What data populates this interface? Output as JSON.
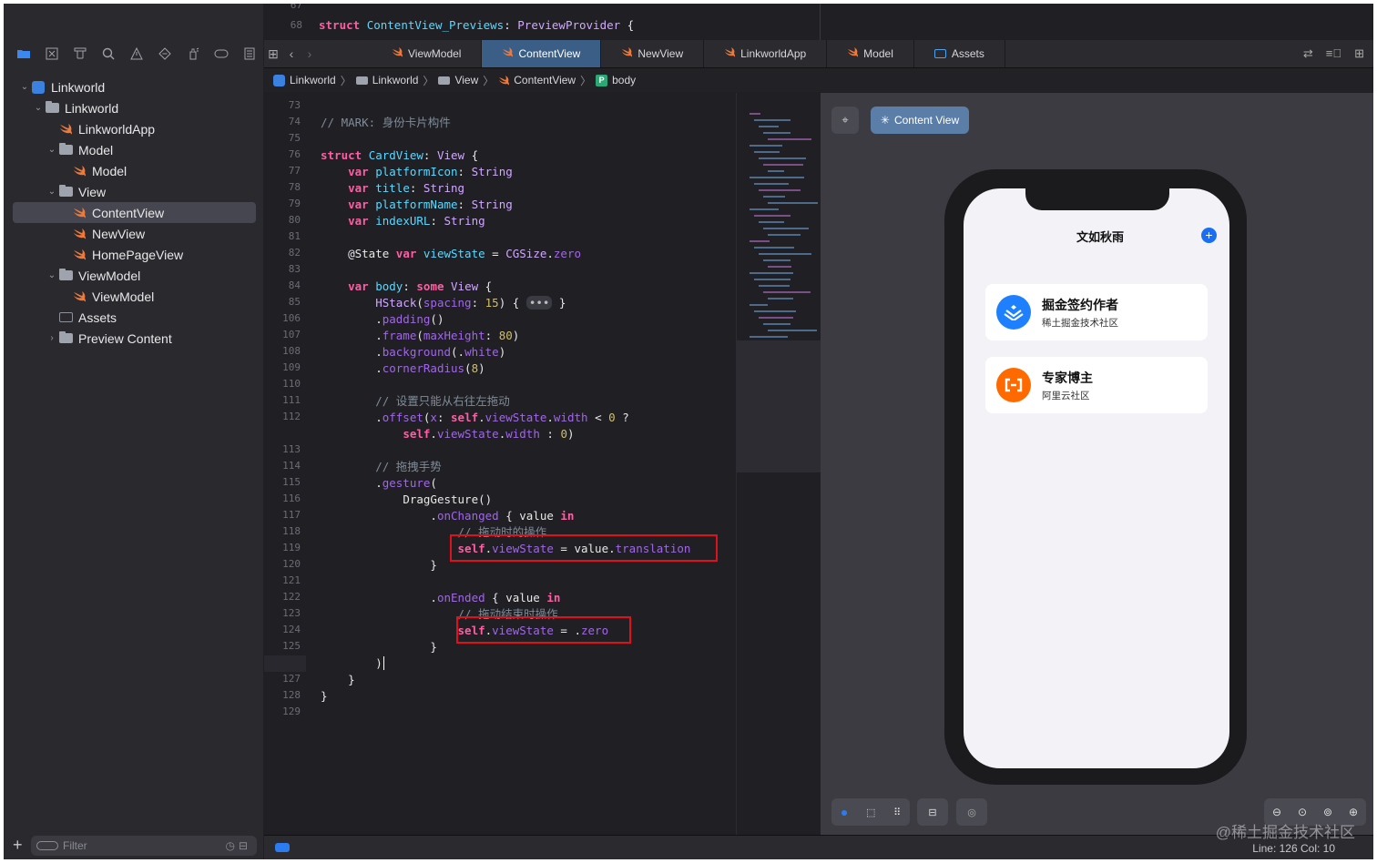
{
  "top_code": {
    "line_no_67": "67",
    "line_no_68": "68",
    "line_68_kw": "struct",
    "line_68_name": "ContentView_Previews",
    "line_68_rest": ": ",
    "line_68_type": "PreviewProvider",
    "line_68_end": " {"
  },
  "toolbar": {
    "icons": [
      "folder-icon",
      "x-square-icon",
      "hierarchy-icon",
      "search-icon",
      "warning-icon",
      "diamond-icon",
      "spray-icon",
      "tag-icon",
      "list-icon"
    ]
  },
  "tree": [
    {
      "label": "Linkworld",
      "depth": 0,
      "icon": "project-icon",
      "disclosure": "open"
    },
    {
      "label": "Linkworld",
      "depth": 1,
      "icon": "folder-icon",
      "disclosure": "open"
    },
    {
      "label": "LinkworldApp",
      "depth": 2,
      "icon": "swift-icon",
      "disclosure": ""
    },
    {
      "label": "Model",
      "depth": 2,
      "icon": "folder-icon",
      "disclosure": "open"
    },
    {
      "label": "Model",
      "depth": 3,
      "icon": "swift-icon",
      "disclosure": ""
    },
    {
      "label": "View",
      "depth": 2,
      "icon": "folder-icon",
      "disclosure": "open"
    },
    {
      "label": "ContentView",
      "depth": 3,
      "icon": "swift-icon",
      "disclosure": "",
      "selected": true
    },
    {
      "label": "NewView",
      "depth": 3,
      "icon": "swift-icon",
      "disclosure": ""
    },
    {
      "label": "HomePageView",
      "depth": 3,
      "icon": "swift-icon",
      "disclosure": ""
    },
    {
      "label": "ViewModel",
      "depth": 2,
      "icon": "folder-icon",
      "disclosure": "open"
    },
    {
      "label": "ViewModel",
      "depth": 3,
      "icon": "swift-icon",
      "disclosure": ""
    },
    {
      "label": "Assets",
      "depth": 2,
      "icon": "assets-icon",
      "disclosure": ""
    },
    {
      "label": "Preview Content",
      "depth": 2,
      "icon": "folder-icon",
      "disclosure": "closed"
    }
  ],
  "filter": {
    "placeholder": "Filter"
  },
  "tabs": [
    {
      "label": "ViewModel",
      "active": false
    },
    {
      "label": "ContentView",
      "active": true
    },
    {
      "label": "NewView",
      "active": false
    },
    {
      "label": "LinkworldApp",
      "active": false
    },
    {
      "label": "Model",
      "active": false
    },
    {
      "label": "Assets",
      "active": false
    }
  ],
  "breadcrumb": [
    "Linkworld",
    "Linkworld",
    "View",
    "ContentView",
    "body"
  ],
  "code_lines": [
    {
      "n": "73",
      "html": ""
    },
    {
      "n": "74",
      "html": "<span class='cm'>// MARK: 身份卡片构件</span>"
    },
    {
      "n": "75",
      "html": ""
    },
    {
      "n": "76",
      "html": "<span class='kw'>struct</span> <span class='ty'>CardView</span>: <span class='tp'>View</span> {"
    },
    {
      "n": "77",
      "html": "    <span class='kw'>var</span> <span class='ty'>platformIcon</span>: <span class='tp'>String</span>"
    },
    {
      "n": "78",
      "html": "    <span class='kw'>var</span> <span class='ty'>title</span>: <span class='tp'>String</span>"
    },
    {
      "n": "79",
      "html": "    <span class='kw'>var</span> <span class='ty'>platformName</span>: <span class='tp'>String</span>"
    },
    {
      "n": "80",
      "html": "    <span class='kw'>var</span> <span class='ty'>indexURL</span>: <span class='tp'>String</span>"
    },
    {
      "n": "81",
      "html": ""
    },
    {
      "n": "82",
      "html": "    @State <span class='kw'>var</span> <span class='ty'>viewState</span> = <span class='tp'>CGSize</span>.<span class='pr'>zero</span>"
    },
    {
      "n": "83",
      "html": ""
    },
    {
      "n": "84",
      "html": "    <span class='kw'>var</span> <span class='ty'>body</span>: <span class='kw'>some</span> <span class='tp'>View</span> {"
    },
    {
      "n": "85",
      "html": "        <span class='tp'>HStack</span>(<span class='pr'>spacing</span>: <span class='num'>15</span>) { <span style='background:#3a3a42;border-radius:6px;padding:0 3px;color:#bbb'>•••</span> }"
    },
    {
      "n": "106",
      "html": "        .<span class='fn'>padding</span>()"
    },
    {
      "n": "107",
      "html": "        .<span class='fn'>frame</span>(<span class='pr'>maxHeight</span>: <span class='num'>80</span>)"
    },
    {
      "n": "108",
      "html": "        .<span class='fn'>background</span>(.<span class='pr'>white</span>)"
    },
    {
      "n": "109",
      "html": "        .<span class='fn'>cornerRadius</span>(<span class='num'>8</span>)"
    },
    {
      "n": "110",
      "html": ""
    },
    {
      "n": "111",
      "html": "        <span class='cm'>// 设置只能从右往左拖动</span>"
    },
    {
      "n": "112",
      "html": "        .<span class='fn'>offset</span>(<span class='pr'>x</span>: <span class='kw'>self</span>.<span class='pr'>viewState</span>.<span class='pr'>width</span> &lt; <span class='num'>0</span> ?"
    },
    {
      "n": "",
      "html": "            <span class='kw'>self</span>.<span class='pr'>viewState</span>.<span class='pr'>width</span> : <span class='num'>0</span>)"
    },
    {
      "n": "113",
      "html": ""
    },
    {
      "n": "114",
      "html": "        <span class='cm'>// 拖拽手势</span>"
    },
    {
      "n": "115",
      "html": "        .<span class='fn'>gesture</span>("
    },
    {
      "n": "116",
      "html": "            <span class='pl'>DragGesture</span>()"
    },
    {
      "n": "117",
      "html": "                .<span class='fn'>onChanged</span> { value <span class='kw'>in</span>"
    },
    {
      "n": "118",
      "html": "                    <span class='cm'>// 拖动时的操作</span>"
    },
    {
      "n": "119",
      "html": "                    <span class='kw'>self</span>.<span class='pr'>viewState</span> = value.<span class='pr'>translation</span>"
    },
    {
      "n": "120",
      "html": "                }"
    },
    {
      "n": "121",
      "html": ""
    },
    {
      "n": "122",
      "html": "                .<span class='fn'>onEnded</span> { value <span class='kw'>in</span>"
    },
    {
      "n": "123",
      "html": "                    <span class='cm'>// 拖动结束时操作</span>"
    },
    {
      "n": "124",
      "html": "                    <span class='kw'>self</span>.<span class='pr'>viewState</span> = .<span class='pr'>zero</span>"
    },
    {
      "n": "125",
      "html": "                }"
    },
    {
      "n": "126",
      "html": "        )<span style='border-left:1.5px solid #fff;margin-left:1px'></span>"
    },
    {
      "n": "127",
      "html": "    }"
    },
    {
      "n": "128",
      "html": "}"
    },
    {
      "n": "129",
      "html": ""
    }
  ],
  "canvas": {
    "preview_button": "Content View",
    "app_title": "文如秋雨",
    "cards": [
      {
        "title": "掘金签约作者",
        "subtitle": "稀土掘金技术社区",
        "color": "#1e80ff"
      },
      {
        "title": "专家博主",
        "subtitle": "阿里云社区",
        "color": "#ff6a00"
      }
    ]
  },
  "status": {
    "linecol": "Line: 126  Col: 10"
  },
  "watermark": "@稀土掘金技术社区",
  "colors": {
    "accent": "#3a88f0",
    "highlight": "#e0101e",
    "active_tab": "#3b5e86"
  }
}
